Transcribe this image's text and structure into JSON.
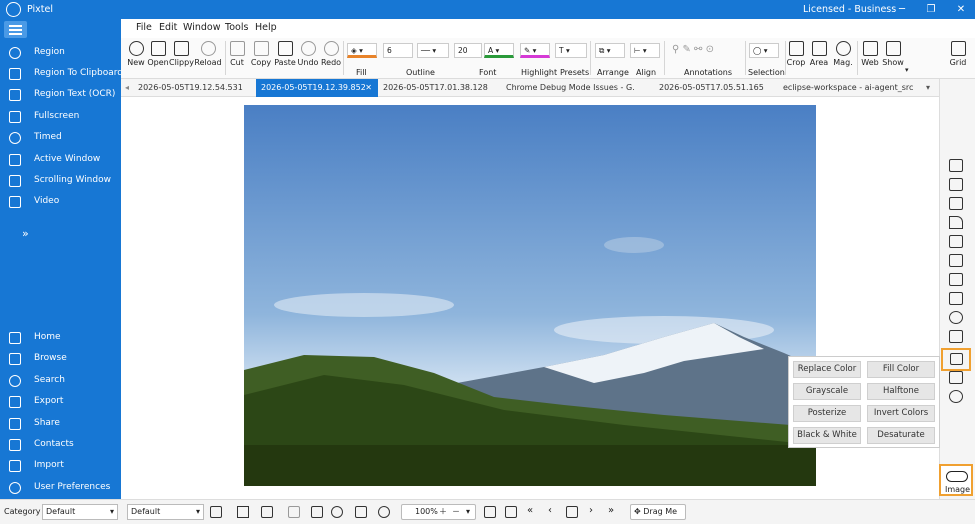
{
  "titlebar": {
    "title": "Pixtel",
    "license": "Licensed - Business",
    "min": "─",
    "restore": "❐",
    "close": "✕"
  },
  "sidebar": {
    "items": [
      "Region",
      "Region To Clipboard",
      "Region Text (OCR)",
      "Fullscreen",
      "Timed",
      "Active Window",
      "Scrolling Window",
      "Video"
    ],
    "expand": "»",
    "bottom_items": [
      "Home",
      "Browse",
      "Search",
      "Export",
      "Share",
      "Contacts",
      "Import",
      "User Preferences"
    ]
  },
  "menu": {
    "items": [
      "File",
      "Edit",
      "Window",
      "Tools",
      "Help"
    ]
  },
  "toolbar": {
    "buttons": [
      "New",
      "Open",
      "Clippy",
      "Reload",
      "Cut",
      "Copy",
      "Paste",
      "Undo",
      "Redo"
    ],
    "fill_label": "Fill",
    "outline_label": "Outline",
    "outline_width": "6",
    "font_label": "Font",
    "font_size": "20",
    "highlight_label": "Highlight",
    "presets_label": "Presets",
    "arrange_label": "Arrange",
    "align_label": "Align",
    "annotations_label": "Annotations",
    "selection_label": "Selection",
    "right_buttons": [
      "Crop",
      "Area",
      "Mag.",
      "Web",
      "Show"
    ],
    "grid_label": "Grid"
  },
  "tabs": [
    "2026-05-05T19.12.54.531",
    "2026-05-05T19.12.39.852",
    "2026-05-05T17.01.38.128",
    "Chrome Debug Mode Issues - G...",
    "2026-05-05T17.05.51.165",
    "eclipse-workspace - ai-agent_src..."
  ],
  "image_menu": [
    [
      "Replace Color",
      "Fill Color"
    ],
    [
      "Grayscale",
      "Halftone"
    ],
    [
      "Posterize",
      "Invert Colors"
    ],
    [
      "Black & White",
      "Desaturate"
    ]
  ],
  "image_toggle": "Image",
  "status": {
    "category_label": "Category",
    "category_value": "Default",
    "style_value": "Default",
    "zoom": "100%",
    "drag_me": "Drag Me"
  }
}
